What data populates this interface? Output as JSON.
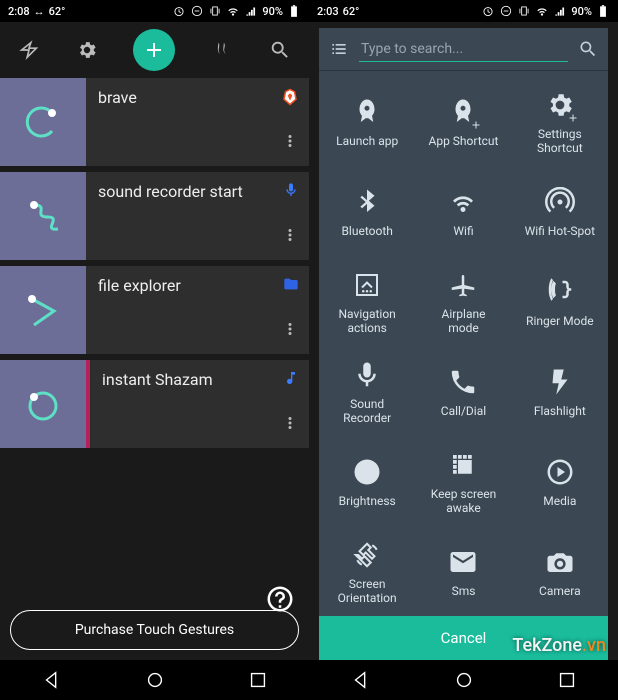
{
  "left": {
    "status": {
      "time": "2:08",
      "arrow": "↔",
      "temp": "62°",
      "battery_pct": "90%"
    },
    "gestures": [
      {
        "title": "brave",
        "indicator": "brave-badge",
        "thumb": "c-shape",
        "bar": false
      },
      {
        "title": "sound recorder start",
        "indicator": "mic-blue",
        "thumb": "s-shape",
        "bar": false
      },
      {
        "title": "file explorer",
        "indicator": "folder-blue",
        "thumb": "angle-shape",
        "bar": false
      },
      {
        "title": "instant Shazam",
        "indicator": "music-blue",
        "thumb": "circle-shape",
        "bar": true
      }
    ],
    "purchase_label": "Purchase Touch Gestures"
  },
  "right": {
    "status": {
      "time": "2:03",
      "temp": "62°",
      "battery_pct": "90%"
    },
    "search_placeholder": "Type to search...",
    "cancel_label": "Cancel",
    "actions": [
      {
        "label": "Launch app",
        "icon": "rocket"
      },
      {
        "label": "App Shortcut",
        "icon": "rocket-plus"
      },
      {
        "label": "Settings\nShortcut",
        "icon": "gear-plus"
      },
      {
        "label": "Bluetooth",
        "icon": "bluetooth"
      },
      {
        "label": "Wifi",
        "icon": "wifi"
      },
      {
        "label": "Wifi Hot-Spot",
        "icon": "hotspot"
      },
      {
        "label": "Navigation\nactions",
        "icon": "nav-actions"
      },
      {
        "label": "Airplane\nmode",
        "icon": "airplane"
      },
      {
        "label": "Ringer Mode",
        "icon": "ringer"
      },
      {
        "label": "Sound\nRecorder",
        "icon": "mic"
      },
      {
        "label": "Call/Dial",
        "icon": "phone"
      },
      {
        "label": "Flashlight",
        "icon": "flash"
      },
      {
        "label": "Brightness",
        "icon": "brightness"
      },
      {
        "label": "Keep screen\nawake",
        "icon": "keep-awake"
      },
      {
        "label": "Media",
        "icon": "play"
      },
      {
        "label": "Screen\nOrientation",
        "icon": "orientation"
      },
      {
        "label": "Sms",
        "icon": "sms"
      },
      {
        "label": "Camera",
        "icon": "camera"
      }
    ]
  },
  "watermark": {
    "name": "TekZone",
    "suffix": ".vn"
  }
}
